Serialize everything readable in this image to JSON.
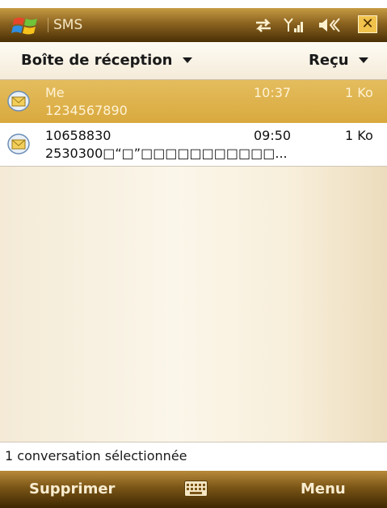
{
  "title_bar": {
    "app_title": "SMS",
    "close_label": "✕"
  },
  "folder_bar": {
    "folder": "Boîte de réception",
    "sort": "Reçu"
  },
  "messages": [
    {
      "sender": "Me",
      "time": "10:37",
      "size": "1 Ko",
      "preview": "1234567890",
      "selected": true
    },
    {
      "sender": "10658830",
      "time": "09:50",
      "size": "1 Ko",
      "preview": "2530300□“□”□□□□□□□□□□□...",
      "selected": false
    }
  ],
  "status": {
    "text": "1 conversation sélectionnée"
  },
  "softkeys": {
    "left": "Supprimer",
    "right": "Menu"
  },
  "colors": {
    "accent": "#d9a93e",
    "title_bar": "#8b6320",
    "softkey_bar": "#7a5516"
  }
}
